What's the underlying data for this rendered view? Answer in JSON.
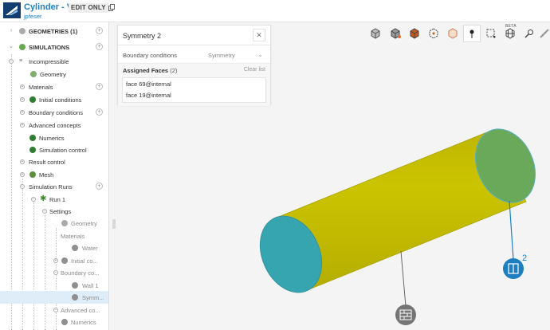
{
  "header": {
    "title": "Cylinder - V1",
    "user": "jpfeser",
    "mode_badge": "EDIT ONLY",
    "brand_color": "#1d7fbf"
  },
  "tree": {
    "geometries": {
      "label": "GEOMETRIES",
      "count": "(1)"
    },
    "simulations": {
      "label": "SIMULATIONS"
    },
    "items": {
      "incompressible": "Incompressible",
      "geometry": "Geometry",
      "materials": "Materials",
      "initial_conditions": "Initial conditions",
      "boundary_conditions": "Boundary conditions",
      "advanced_concepts": "Advanced concepts",
      "numerics": "Numerics",
      "simulation_control": "Simulation control",
      "result_control": "Result control",
      "mesh": "Mesh",
      "simulation_runs": "Simulation Runs",
      "run1": "Run 1",
      "settings": "Settings",
      "run_geometry": "Geometry",
      "run_materials": "Materials",
      "water": "Water",
      "run_initial": "Initial co...",
      "run_boundary": "Boundary co...",
      "wall1": "Wall 1",
      "symm": "Symm...",
      "run_advanced": "Advanced co...",
      "run_numerics": "Numerics"
    }
  },
  "panel": {
    "title": "Symmetry 2",
    "close_icon": "close-icon",
    "bc_label": "Boundary conditions",
    "bc_value": "Symmetry",
    "assigned_label": "Assigned Faces",
    "assigned_count": "(2)",
    "clear_label": "Clear list",
    "faces": [
      "face 69@internal",
      "face 19@internal"
    ]
  },
  "toolbar": {
    "beta_label": "BETA",
    "icons": [
      "cube-view-icon",
      "cube-select-icon",
      "cube-faces-icon",
      "cube-edges-icon",
      "cube-wire-icon",
      "point-icon",
      "box-select-icon",
      "cube-grid-icon",
      "probe-icon",
      "measure-icon"
    ]
  },
  "viewport": {
    "cylinder_color": "#c8c200",
    "face_color": "#36a5b0",
    "selected_face_color": "#6aa85a",
    "marker_number": "2"
  }
}
